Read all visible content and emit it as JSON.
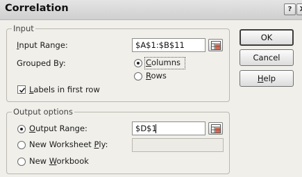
{
  "dialog": {
    "title": "Correlation",
    "titlebar_buttons": {
      "help": "?",
      "close": "X"
    }
  },
  "input": {
    "legend": "Input",
    "input_range_label_prefix": "",
    "input_range_label_underlined": "I",
    "input_range_label_suffix": "nput Range:",
    "input_range_value": "$A$1:$B$11",
    "grouped_by_label": "Grouped By:",
    "options": [
      {
        "prefix": "",
        "underlined": "C",
        "suffix": "olumns",
        "selected": true
      },
      {
        "prefix": "",
        "underlined": "R",
        "suffix": "ows",
        "selected": false
      }
    ],
    "labels_checkbox": {
      "prefix": "",
      "underlined": "L",
      "suffix": "abels in first row",
      "checked": true
    }
  },
  "output": {
    "legend": "Output options",
    "options": [
      {
        "prefix": "",
        "underlined": "O",
        "suffix": "utput Range:",
        "selected": true,
        "value": "$D$1"
      },
      {
        "prefix": "New Worksheet ",
        "underlined": "P",
        "suffix": "ly:",
        "selected": false,
        "value": ""
      },
      {
        "prefix": "New ",
        "underlined": "W",
        "suffix": "orkbook",
        "selected": false
      }
    ]
  },
  "buttons": {
    "ok": "OK",
    "cancel": "Cancel",
    "help_prefix": "",
    "help_underlined": "H",
    "help_suffix": "elp"
  }
}
